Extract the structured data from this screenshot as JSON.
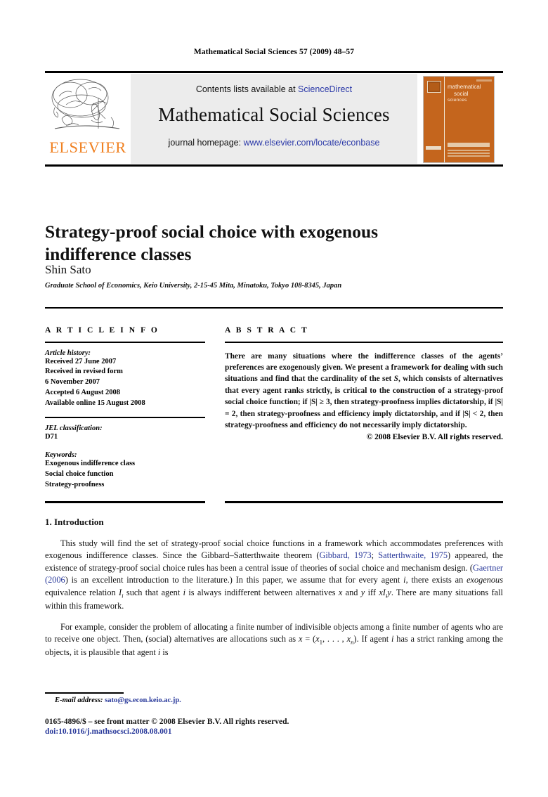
{
  "running_head": "Mathematical Social Sciences 57 (2009) 48–57",
  "masthead": {
    "contents_prefix": "Contents lists available at ",
    "sciencedirect": "ScienceDirect",
    "journal_name": "Mathematical Social Sciences",
    "homepage_prefix": "journal homepage: ",
    "homepage_url": "www.elsevier.com/locate/econbase",
    "publisher_wordmark": "ELSEVIER",
    "band_color": "#ececec",
    "link_color": "#2b39a8",
    "elsevier_orange": "#f08122"
  },
  "cover": {
    "line1": "mathematical",
    "line2": "social",
    "line3": "sciences",
    "background": "#c4651d"
  },
  "article": {
    "title": "Strategy-proof social choice with exogenous indifference classes",
    "author": "Shin Sato",
    "affiliation": "Graduate School of Economics, Keio University, 2-15-45 Mita, Minatoku, Tokyo 108-8345, Japan"
  },
  "info": {
    "heading": "A R T I C L E    I N F O",
    "history_label": "Article history:",
    "history": [
      "Received 27 June 2007",
      "Received in revised form",
      "6 November 2007",
      "Accepted 6 August 2008",
      "Available online 15 August 2008"
    ],
    "jel_label": "JEL classification:",
    "jel_value": "D71",
    "keywords_label": "Keywords:",
    "keywords": [
      "Exogenous indifference class",
      "Social choice function",
      "Strategy-proofness"
    ]
  },
  "abstract": {
    "heading": "A B S T R A C T",
    "text_part1": "There are many situations where the indifference classes of the agents’ preferences are exogenously given. We present a framework for dealing with such situations and find that the cardinality of the set ",
    "set_symbol": "S",
    "text_part2": ", which consists of alternatives that every agent ranks strictly, is critical to the construction of a strategy-proof social choice function; if |S| ≥ 3, then strategy-proofness implies dictatorship, if |S| = 2, then strategy-proofness and efficiency imply dictatorship, and if |S| < 2, then strategy-proofness and efficiency do not necessarily imply dictatorship.",
    "copyright": "© 2008 Elsevier B.V. All rights reserved."
  },
  "body": {
    "section_number": "1.",
    "section_title": "Introduction",
    "p1_a": "This study will find the set of strategy-proof social choice functions in a framework which accommodates preferences with exogenous indifference classes. Since the Gibbard–Satterthwaite theorem (",
    "cite_gibbard": "Gibbard, 1973",
    "p1_b": "; ",
    "cite_satterthwaite": "Satterthwaite, 1975",
    "p1_c": ") appeared, the existence of strategy-proof social choice rules has been a central issue of theories of social choice and mechanism design. (",
    "cite_gaertner": "Gaertner (2006",
    "p1_d": ") is an excellent introduction to the literature.) In this paper, we assume that for every agent ",
    "var_i": "i",
    "p1_e": ", there exists an ",
    "em_exogenous": "exogenous",
    "p1_f": " equivalence relation ",
    "var_I": "I",
    "var_I_sub": "i",
    "p1_g": " such that agent ",
    "p1_h": " is always indifferent between alternatives ",
    "var_x": "x",
    "p1_i": " and ",
    "var_y": "y",
    "p1_j": " iff ",
    "var_xIy": "xI",
    "var_xIy_sub": "i",
    "var_xIy_end": "y",
    "p1_k": ". There are many situations fall within this framework.",
    "p2_a": "For example, consider the problem of allocating a finite number of indivisible objects among a finite number of agents who are to receive one object. Then, (social) alternatives are allocations such as ",
    "p2_x": "x",
    "p2_eq": " = (",
    "p2_x1": "x",
    "p2_x1_sub": "1",
    "p2_dots": ", . . . , ",
    "p2_xn": "x",
    "p2_xn_sub": "n",
    "p2_b": "). If agent ",
    "p2_c": " has a strict ranking among the objects, it is plausible that agent ",
    "p2_d": " is"
  },
  "footnote": {
    "label": "E-mail address:",
    "email": "sato@gs.econ.keio.ac.jp."
  },
  "bottom": {
    "issn_line": "0165-4896/$ – see front matter © 2008 Elsevier B.V. All rights reserved.",
    "doi_line": "doi:10.1016/j.mathsocsci.2008.08.001"
  }
}
